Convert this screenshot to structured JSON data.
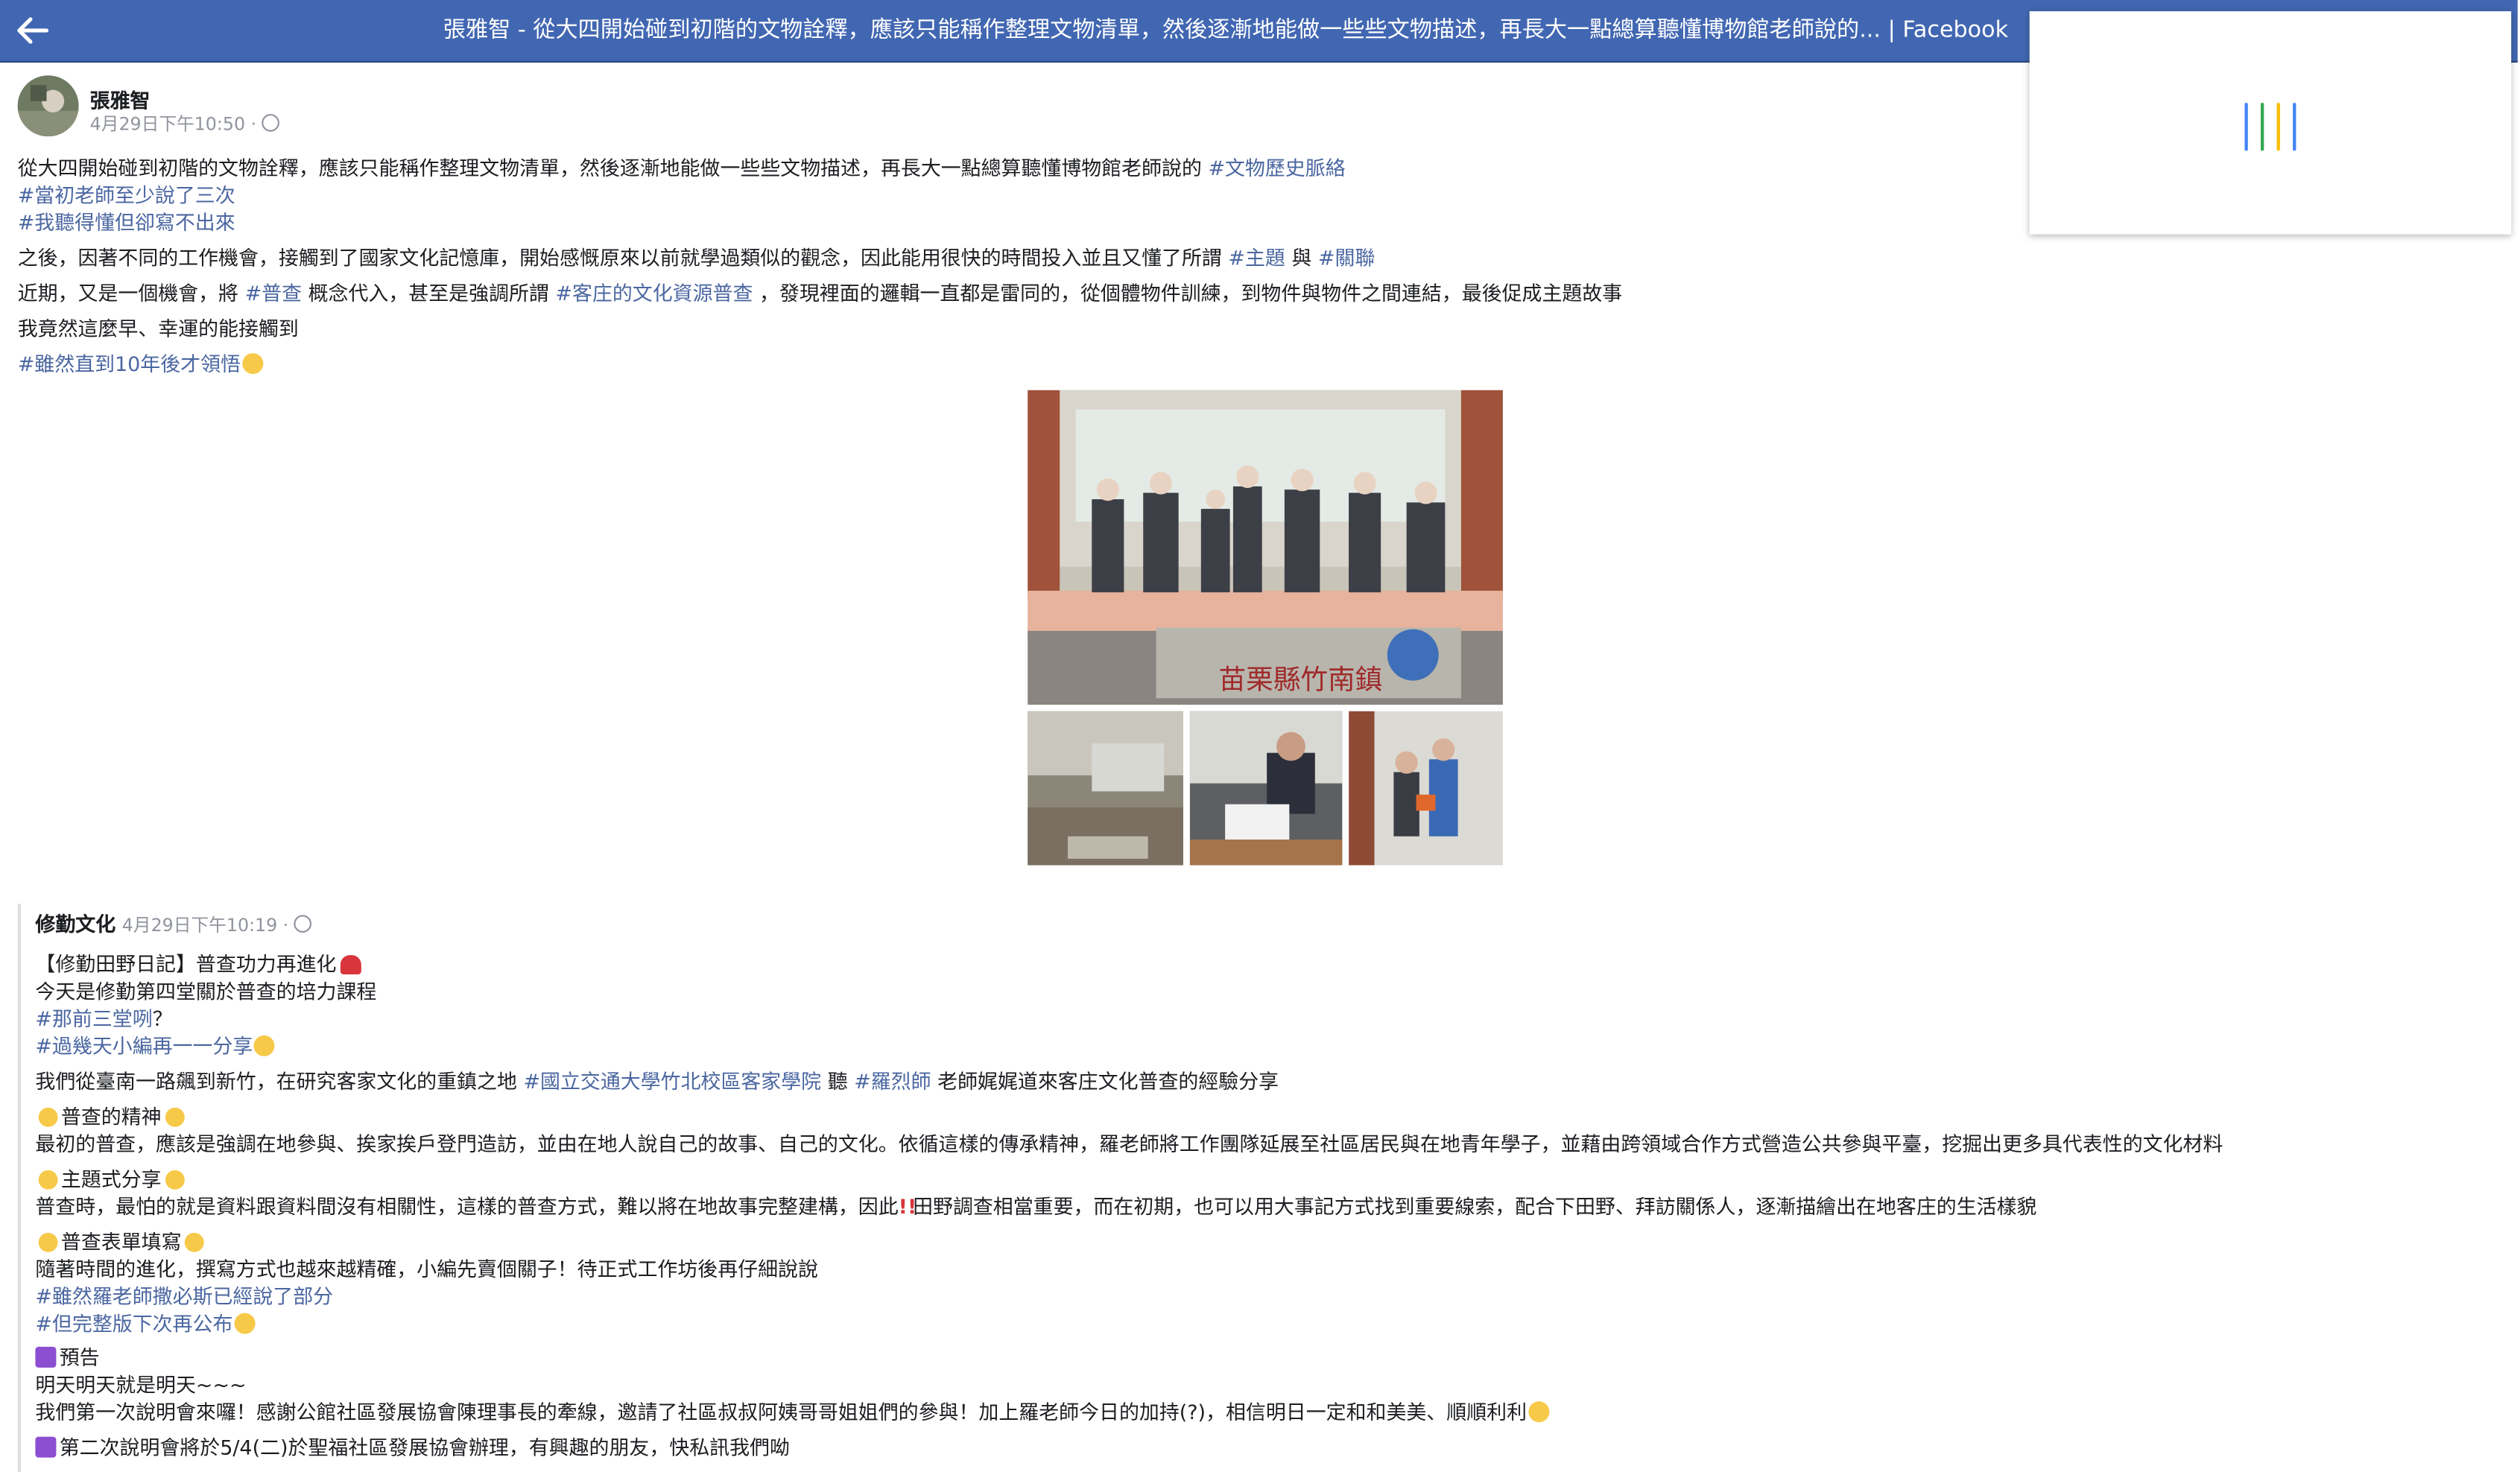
{
  "header": {
    "title": "張雅智 - 從大四開始碰到初階的文物詮釋，應該只能稱作整理文物清單，然後逐漸地能做一些些文物描述，再長大一點總算聽懂博物館老師說的... | Facebook"
  },
  "post": {
    "author": "張雅智",
    "timestamp": "4月29日下午10:50 ·",
    "lines": [
      {
        "text": "從大四開始碰到初階的文物詮釋，應該只能稱作整理文物清單，然後逐漸地能做一些些文物描述，再長大一點總算聽懂博物館老師說的 ",
        "tag": "#文物歷史脈絡"
      },
      {
        "tag": "#當初老師至少說了三次"
      },
      {
        "tag": "#我聽得懂但卻寫不出來"
      },
      {
        "text": "之後，因著不同的工作機會，接觸到了國家文化記憶庫，開始感慨原來以前就學過類似的觀念，因此能用很快的時間投入並且又懂了所謂 ",
        "tag": "#主題",
        "text2": " 與 ",
        "tag2": "#關聯"
      },
      {
        "text": "近期，又是一個機會，將 ",
        "tag": "#普查",
        "text2": " 概念代入，甚至是強調所謂 ",
        "tag2": "#客庄的文化資源普查",
        "text3": " ，發現裡面的邏輯一直都是雷同的，從個體物件訓練，到物件與物件之間連結，最後促成主題故事"
      },
      {
        "text": "我竟然這麼早、幸運的能接觸到"
      },
      {
        "tag": "#雖然直到10年後才領悟"
      }
    ],
    "banner_text": "苗栗縣竹南鎮"
  },
  "shared": {
    "author": "修勤文化",
    "timestamp": "4月29日下午10:19 ·",
    "lines": [
      {
        "text": "【修勤田野日記】普查功力再進化"
      },
      {
        "text": "今天是修勤第四堂關於普查的培力課程"
      },
      {
        "tag": "#那前三堂咧",
        "text": "？"
      },
      {
        "tag": "#過幾天小編再一一分享"
      },
      {
        "text": "我們從臺南一路飆到新竹，在研究客家文化的重鎮之地 ",
        "tag": "#國立交通大學竹北校區客家學院",
        "text2": " 聽 ",
        "tag2": "#羅烈師",
        "text3": " 老師娓娓道來客庄文化普查的經驗分享"
      },
      {
        "text": "普查的精神"
      },
      {
        "text": "最初的普查，應該是強調在地參與、挨家挨戶登門造訪，並由在地人說自己的故事、自己的文化。依循這樣的傳承精神，羅老師將工作團隊延展至社區居民與在地青年學子，並藉由跨領域合作方式營造公共參與平臺，挖掘出更多具代表性的文化材料"
      },
      {
        "text": "主題式分享"
      },
      {
        "text": "普查時，最怕的就是資料跟資料間沒有相關性，這樣的普查方式，難以將在地故事完整建構，因此",
        "text2": "田野調查相當重要，而在初期，也可以用大事記方式找到重要線索，配合下田野、拜訪關係人，逐漸描繪出在地客庄的生活樣貌"
      },
      {
        "text": "普查表單填寫"
      },
      {
        "text": "隨著時間的進化，撰寫方式也越來越精確，小編先賣個關子！待正式工作坊後再仔細說說"
      },
      {
        "tag": "#雖然羅老師撒必斯已經說了部分"
      },
      {
        "tag": "#但完整版下次再公布"
      },
      {
        "text": "預告"
      },
      {
        "text": "明天明天就是明天~~~"
      },
      {
        "text": "我們第一次說明會來囉！感謝公館社區發展協會陳理事長的牽線，邀請了社區叔叔阿姨哥哥姐姐們的參與！加上羅老師今日的加持(?)，相信明日一定和和美美、順順利利"
      },
      {
        "text": "第二次說明會將於5/4(二)於聖福社區發展協會辦理，有興趣的朋友，快私訊我們呦"
      }
    ]
  },
  "colors": {
    "header_bg": "#4267b2",
    "hashtag": "#4b67a1",
    "meta_gray": "#90949c"
  }
}
